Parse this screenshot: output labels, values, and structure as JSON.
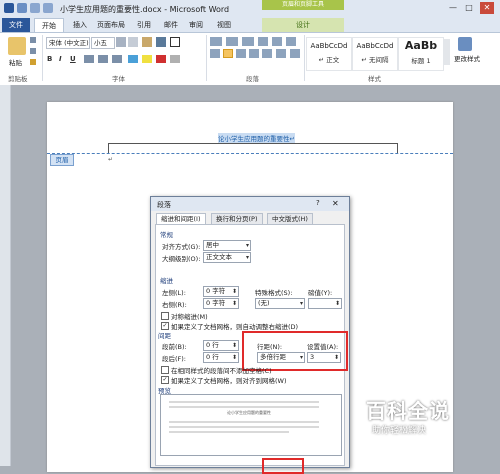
{
  "window": {
    "doc_title": "小学生应用题的重要性.docx - Microsoft Word",
    "header_tools_tab": "页眉和页脚工具",
    "min": "—",
    "max": "□",
    "close": "✕"
  },
  "tabs": [
    "文件",
    "开始",
    "插入",
    "页面布局",
    "引用",
    "邮件",
    "审阅",
    "视图",
    "设计"
  ],
  "ribbon": {
    "paste": "粘贴",
    "font_name": "宋体 (中文正)",
    "font_size": "小五",
    "bold": "B",
    "italic": "I",
    "underline": "U",
    "groups": {
      "clipboard": "剪贴板",
      "font": "字体",
      "paragraph": "段落",
      "styles": "样式"
    },
    "styles": [
      {
        "sample": "AaBbCcDd",
        "name": "↵ 正文"
      },
      {
        "sample": "AaBbCcDd",
        "name": "↵ 无间隔"
      },
      {
        "sample": "AaBb",
        "name": "标题 1"
      }
    ],
    "change_styles": "更改样式"
  },
  "document": {
    "heading": "论小学生应用题的重要性↵",
    "header_tag": "页眉",
    "cursor": "↵"
  },
  "dialog": {
    "title": "段落",
    "help": "?",
    "close": "✕",
    "tabs": [
      "缩进和间距(I)",
      "换行和分页(P)",
      "中文版式(H)"
    ],
    "general": {
      "section": "常规",
      "alignment_label": "对齐方式(G):",
      "alignment_value": "居中",
      "outline_label": "大纲级别(O):",
      "outline_value": "正文文本"
    },
    "indent": {
      "section": "缩进",
      "left_label": "左侧(L):",
      "left_value": "0 字符",
      "right_label": "右侧(R):",
      "right_value": "0 字符",
      "special_label": "特殊格式(S):",
      "special_value": "(无)",
      "by_label": "磅值(Y):",
      "by_value": "",
      "mirror": "对称缩进(M)",
      "auto_adjust": "如果定义了文档网格，则自动调整右缩进(D)"
    },
    "spacing": {
      "section": "间距",
      "before_label": "段前(B):",
      "before_value": "0 行",
      "after_label": "段后(F):",
      "after_value": "0 行",
      "line_label": "行距(N):",
      "line_value": "多倍行距",
      "at_label": "设置值(A):",
      "at_value": "3",
      "no_space": "在相同样式的段落间不添加空格(C)",
      "snap": "如果定义了文档网格，则对齐到网格(W)"
    },
    "preview": {
      "section": "预览",
      "sample": "论小学生应用题的重要性"
    }
  },
  "watermark": {
    "title": "百科全说",
    "subtitle": "助你轻松解决"
  }
}
